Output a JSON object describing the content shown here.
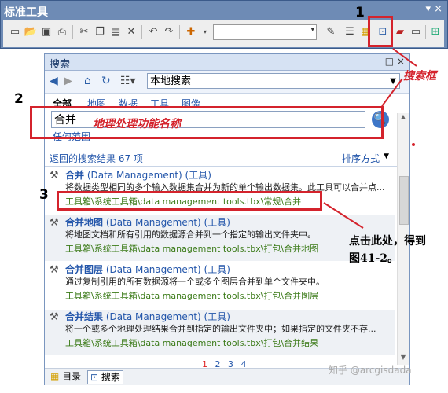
{
  "toolbar": {
    "title": "标准工具",
    "window_buttons": "▾ ×"
  },
  "search_window": {
    "title": "搜索",
    "title_buttons": "□ ×",
    "scope": "本地搜索",
    "tabs": [
      "全部",
      "地图",
      "数据",
      "工具",
      "图像"
    ],
    "query": "合并",
    "spatial_link": "任何范围",
    "return_link": "返回的搜索结果  67 项",
    "sort_link": "排序方式",
    "results": [
      {
        "name": "合并",
        "category": "(Data Management) (工具)",
        "desc": "将数据类型相同的多个输入数据集合并为新的单个输出数据集。此工具可以合并点...",
        "path": "工具箱\\系统工具箱\\data management tools.tbx\\常规\\合并"
      },
      {
        "name": "合并地图",
        "category": "(Data Management) (工具)",
        "desc": "将地图文档和所有引用的数据源合并到一个指定的输出文件夹中。",
        "path": "工具箱\\系统工具箱\\data management tools.tbx\\打包\\合并地图"
      },
      {
        "name": "合并图层",
        "category": "(Data Management) (工具)",
        "desc": "通过复制引用的所有数据源将一个或多个图层合并到单个文件夹中。",
        "path": "工具箱\\系统工具箱\\data management tools.tbx\\打包\\合并图层"
      },
      {
        "name": "合并结果",
        "category": "(Data Management) (工具)",
        "desc": "将一个或多个地理处理结果合并到指定的输出文件夹中；如果指定的文件夹不存...",
        "path": "工具箱\\系统工具箱\\data management tools.tbx\\打包\\合并结果"
      }
    ],
    "pages": [
      "1",
      "2",
      "3",
      "4"
    ],
    "bottom_tabs": [
      "目录",
      "搜索"
    ]
  },
  "annotations": {
    "num1": "1",
    "num2": "2",
    "num3": "3",
    "search_box_label": "搜索框",
    "tool_name_label": "地理处理功能名称",
    "click_note_line1": "点击此处，得到",
    "click_note_line2": "图41-2。"
  },
  "watermark": "知乎 @arcgisdada",
  "colors": {
    "annotation_red": "#d4232c",
    "link_blue": "#2255aa",
    "path_green": "#3a7a17"
  }
}
